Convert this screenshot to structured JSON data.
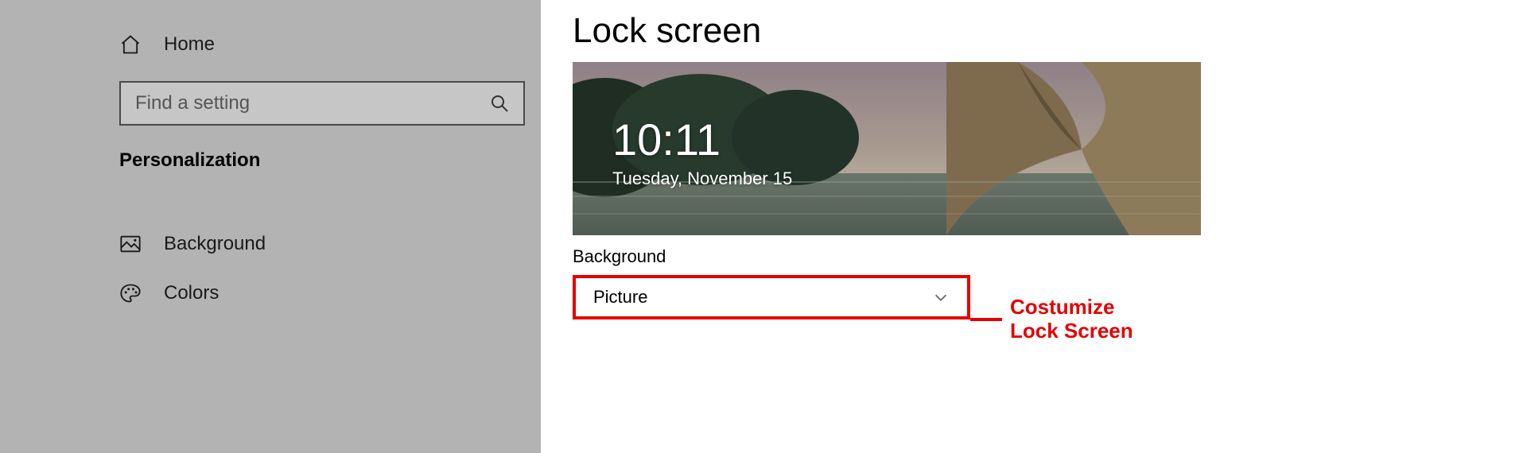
{
  "sidebar": {
    "home_label": "Home",
    "search_placeholder": "Find a setting",
    "category_title": "Personalization",
    "items": [
      {
        "icon": "image-icon",
        "label": "Background"
      },
      {
        "icon": "palette-icon",
        "label": "Colors"
      }
    ]
  },
  "main": {
    "title": "Lock screen",
    "preview": {
      "time": "10:11",
      "date": "Tuesday, November 15"
    },
    "background": {
      "section_label": "Background",
      "selected_value": "Picture"
    },
    "annotation": "Costumize\nLock Screen"
  },
  "colors": {
    "annotation_red": "#e60000"
  }
}
